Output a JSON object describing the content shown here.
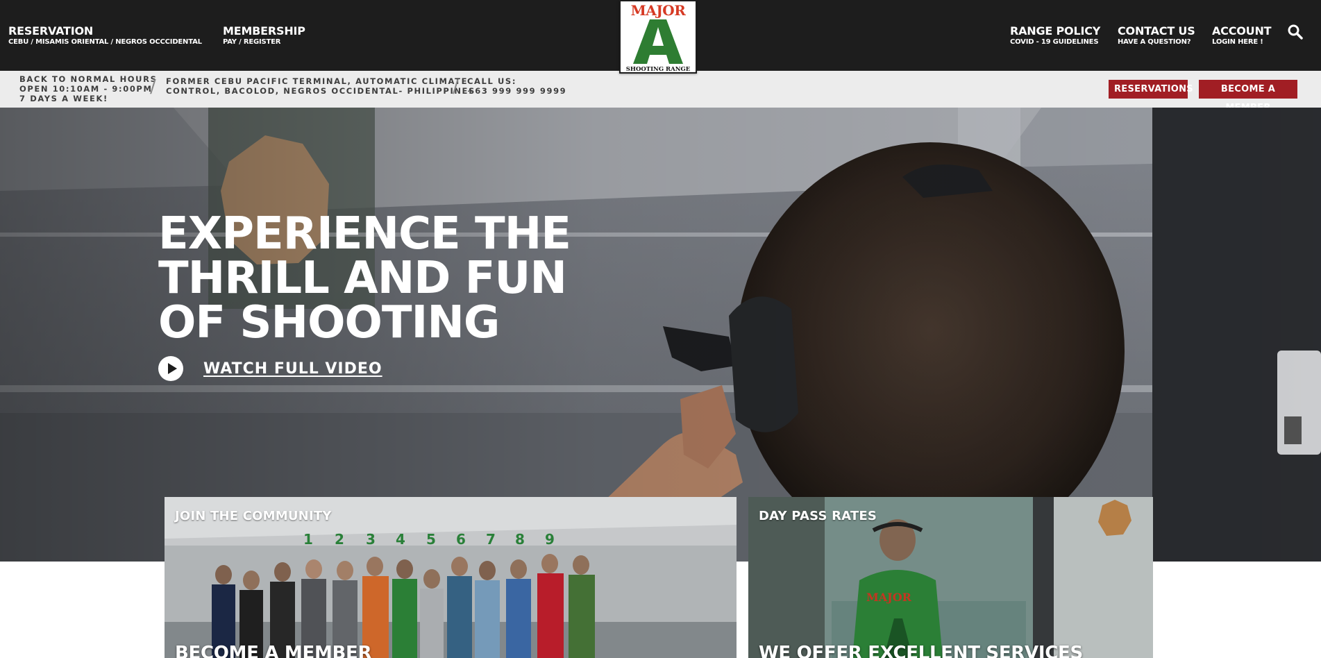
{
  "nav": {
    "reservation": {
      "title": "RESERVATION",
      "subtitle": "CEBU / MISAMIS ORIENTAL / NEGROS OCCCIDENTAL"
    },
    "membership": {
      "title": "MEMBERSHIP",
      "subtitle": "PAY / REGISTER"
    },
    "range_policy": {
      "title": "RANGE POLICY",
      "subtitle": "COVID - 19 GUIDELINES"
    },
    "contact": {
      "title": "CONTACT US",
      "subtitle": "HAVE A QUESTION?"
    },
    "account": {
      "title": "ACCOUNT",
      "subtitle": "LOGIN HERE !"
    },
    "search_icon": "search-icon"
  },
  "logo": {
    "top_text": "MAJOR",
    "letter": "A",
    "bottom_text": "SHOOTING RANGE"
  },
  "infobar": {
    "hours": [
      "BACK TO NORMAL HOURS",
      "OPEN 10:10AM - 9:00PM",
      "7 DAYS A WEEK!"
    ],
    "address": [
      "FORMER CEBU PACIFIC TERMINAL, AUTOMATIC CLIMATE",
      "CONTROL, BACOLOD, NEGROS OCCIDENTAL- PHILIPPINES"
    ],
    "call": [
      "CALL US:",
      "+63 999 999 9999"
    ],
    "separator": "/",
    "reservations_button": "RESERVATIONS",
    "member_button": "BECOME A MEMBER"
  },
  "hero": {
    "heading_lines": [
      "EXPERIENCE THE",
      "THRILL AND FUN",
      "OF SHOOTING"
    ],
    "watch_label": "WATCH FULL VIDEO"
  },
  "cards": [
    {
      "kicker": "JOIN THE COMMUNITY",
      "title": "BECOME A MEMBER"
    },
    {
      "kicker": "DAY PASS RATES",
      "title": "WE OFFER EXCELLENT SERVICES"
    }
  ],
  "colors": {
    "nav_bg": "#1d1d1d",
    "infobar_bg": "#ececec",
    "cta_red": "#a11e24",
    "logo_red": "#d63a24",
    "logo_green": "#2e7d32"
  }
}
